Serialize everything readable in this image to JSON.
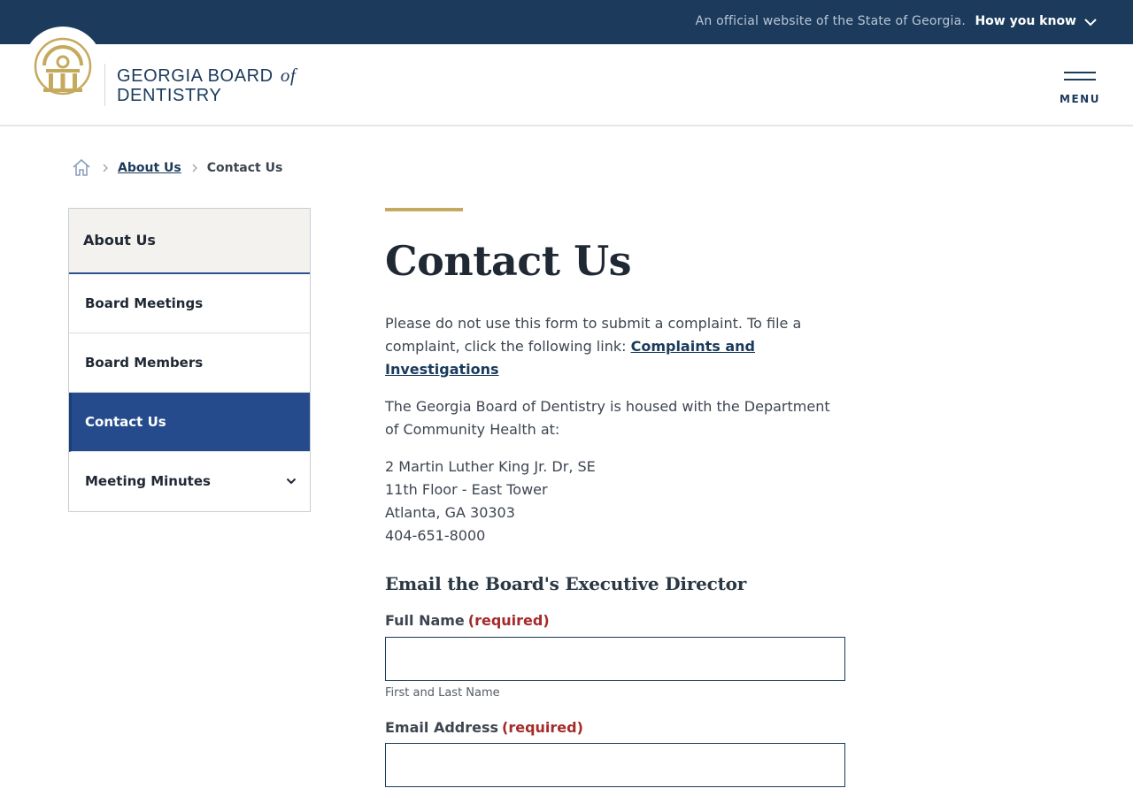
{
  "banner": {
    "official_text": "An official website of the State of Georgia.",
    "how_you_know": "How you know"
  },
  "header": {
    "logo_line1": "GEORGIA BOARD",
    "logo_of": "of",
    "logo_line2": "DENTISTRY",
    "menu_label": "MENU"
  },
  "breadcrumb": {
    "items": [
      "About Us"
    ],
    "current": "Contact Us"
  },
  "sidenav": {
    "heading": "About Us",
    "items": [
      {
        "label": "Board Meetings"
      },
      {
        "label": "Board Members"
      },
      {
        "label": "Contact Us",
        "active": true
      },
      {
        "label": "Meeting Minutes",
        "expandable": true
      }
    ]
  },
  "main": {
    "title": "Contact Us",
    "para1_text": "Please do not use this form to submit a complaint. To file a complaint, click the following link: ",
    "para1_link": "Complaints and Investigations",
    "para2": "The Georgia Board of Dentistry is housed with the Department of Community Health at:",
    "address": {
      "line1": "2 Martin Luther King Jr. Dr, SE",
      "line2": "11th Floor - East Tower",
      "line3": "Atlanta, GA 30303",
      "phone": "404-651-8000"
    },
    "form_title": "Email the Board's Executive Director",
    "fields": {
      "name_label": "Full Name",
      "name_required": "(required)",
      "name_value": "",
      "name_hint": "First and Last Name",
      "email_label": "Email Address",
      "email_required": "(required)",
      "email_value": ""
    }
  },
  "colors": {
    "banner_bg": "#1b3a5c",
    "accent_gold": "#c5a95e",
    "active_nav": "#264b8c",
    "required_red": "#a52a2a"
  }
}
